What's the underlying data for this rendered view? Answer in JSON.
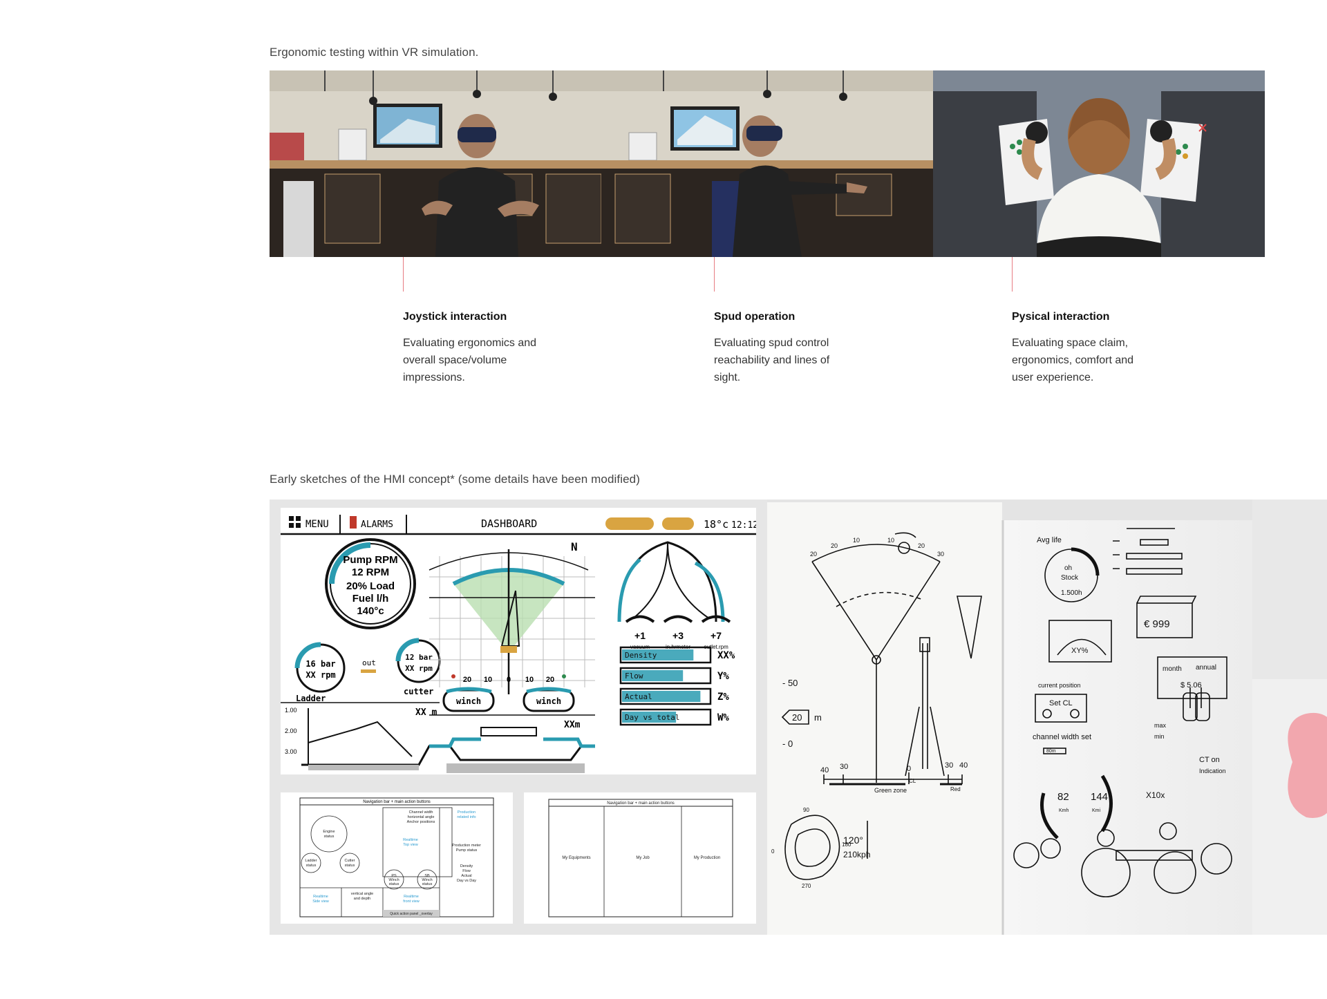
{
  "captions": {
    "top": "Ergonomic testing within VR simulation.",
    "bottom": "Early sketches of the HMI concept* (some details have been modified)"
  },
  "callouts": [
    {
      "title": "Joystick interaction",
      "text": "Evaluating ergonomics and overall space/volume impressions."
    },
    {
      "title": "Spud operation",
      "text": "Evaluating spud control reachability and lines of sight."
    },
    {
      "title": "Pysical interaction",
      "text": "Evaluating space claim, ergonomics, comfort and user experience."
    }
  ],
  "dashboard_sketch": {
    "menu": "MENU",
    "alarms": "ALARMS",
    "title": "DASHBOARD",
    "temp": "18°c",
    "time": "12:12",
    "pump_gauge": [
      "Pump RPM",
      "12 RPM",
      "20% Load",
      "Fuel l/h",
      "140°c"
    ],
    "ladder_gauge": [
      "16 bar",
      "XX rpm"
    ],
    "ladder_label": "Ladder",
    "cutter_gauge": [
      "12 bar",
      "XX rpm"
    ],
    "cutter_label": "cutter",
    "out_label": "out",
    "angle_labels": [
      "+1",
      "+3",
      "+7"
    ],
    "angle_sub": [
      "vacuum",
      "in.hrmeter",
      "outlet.rpm"
    ],
    "winch_labels": [
      "winch",
      "winch"
    ],
    "scale_ticks": [
      "20",
      "10",
      "0",
      "10",
      "20"
    ],
    "depth_ticks": [
      "1.00",
      "2.00",
      "3.00"
    ],
    "depth_marker": "XX m",
    "depth_marker2": "XXm",
    "bars": [
      {
        "label": "Density",
        "value": "XX%",
        "fill": 0.82
      },
      {
        "label": "Flow",
        "value": "Y%",
        "fill": 0.7
      },
      {
        "label": "Actual",
        "value": "Z%",
        "fill": 0.9
      },
      {
        "label": "Day vs total",
        "value": "W%",
        "fill": 0.62
      }
    ]
  },
  "wireframe_1": {
    "header": "Navigation bar + main action buttons",
    "engine": [
      "Engine",
      "status"
    ],
    "ladder": [
      "Ladder",
      "status"
    ],
    "cutter": [
      "Cutter",
      "status"
    ],
    "channel": [
      "Channel width",
      "horizontal angle",
      "Anchor positions"
    ],
    "realtime_top": [
      "Realtime",
      "Top view"
    ],
    "production_info": [
      "Production",
      "related info"
    ],
    "production_meter": [
      "Production meter",
      "Pump status"
    ],
    "density": [
      "Density",
      "Flow",
      "Actual",
      "Day vs Day"
    ],
    "ps_winch": [
      "PS",
      "Winch",
      "status"
    ],
    "sb_winch": [
      "SB",
      "Winch",
      "status"
    ],
    "realtime_side": [
      "Realtime",
      "Side view"
    ],
    "vertical": [
      "vertical angle",
      "and depth"
    ],
    "realtime_front": [
      "Realtime",
      "front view"
    ],
    "quick": "Quick action panel _overlay"
  },
  "wireframe_2": {
    "header": "Navigation bar + main action buttons",
    "columns": [
      "My Equipments",
      "My Job",
      "My Production"
    ]
  },
  "notebook_left": {
    "arc_ticks": [
      "20",
      "20",
      "10",
      "10",
      "20",
      "30"
    ],
    "depth": [
      "- 50",
      "20",
      "m",
      "- 0"
    ],
    "scale": [
      "40",
      "30",
      "0",
      "30",
      "40"
    ],
    "scale_sub": [
      "CL",
      "Green zone",
      "Red"
    ],
    "dial": [
      "90",
      "0",
      "180",
      "270"
    ],
    "dial_value": [
      "120°",
      "210kph"
    ]
  },
  "notebook_right": {
    "title": "Avg life",
    "stock": [
      "oh",
      "Stock",
      "1.500h"
    ],
    "price": "€ 999",
    "percent": "XY%",
    "position": "current position",
    "set_cl": "Set CL",
    "channel": "channel width set",
    "channel_box": "80m",
    "month": "month",
    "annual": "annual",
    "amount": "$ 5.06",
    "max": "max",
    "min": "min",
    "ct": "CT on",
    "indication": "Indication",
    "vals": [
      "82",
      "144"
    ],
    "vals_sub": [
      "Kmh",
      "Kmi"
    ],
    "x10": "X10x"
  }
}
